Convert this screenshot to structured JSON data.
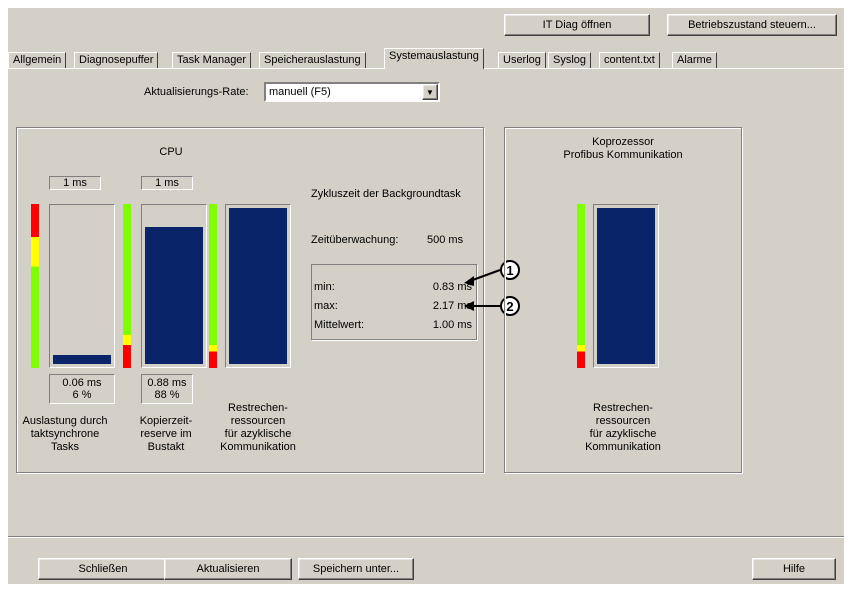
{
  "toolbar": {
    "it_diag": "IT Diag öffnen",
    "betriebszustand": "Betriebszustand steuern..."
  },
  "tabs": [
    "Allgemein",
    "Diagnosepuffer",
    "Task Manager",
    "Speicherauslastung",
    "Systemauslastung",
    "Userlog",
    "Syslog",
    "content.txt",
    "Alarme"
  ],
  "active_tab": "Systemauslastung",
  "rate": {
    "label": "Aktualisierungs-Rate:",
    "value": "manuell (F5)"
  },
  "cpu": {
    "title": "CPU",
    "col1": {
      "top": "1 ms",
      "ms": "0.06 ms",
      "pct": "6 %",
      "fill": 0.06,
      "caption": [
        "Auslastung durch",
        "taktsynchrone",
        "Tasks"
      ]
    },
    "col2": {
      "top": "1 ms",
      "ms": "0.88 ms",
      "pct": "88 %",
      "fill": 0.88,
      "caption": [
        "Kopierzeit-",
        "reserve im",
        "Bustakt"
      ]
    },
    "col3": {
      "fill": 1.0,
      "caption": [
        "Restrechen-",
        "ressourcen",
        "für azyklische",
        "Kommunikation"
      ]
    },
    "cycle_title": "Zykluszeit der Backgroundtask",
    "monitor_label": "Zeitüberwachung:",
    "monitor_value": "500 ms",
    "stats": [
      {
        "label": "min:",
        "value": "0.83 ms"
      },
      {
        "label": "max:",
        "value": "2.17 ms"
      },
      {
        "label": "Mittelwert:",
        "value": "1.00 ms"
      }
    ]
  },
  "callouts": [
    "1",
    "2"
  ],
  "coprocessor": {
    "title1": "Koprozessor",
    "title2": "Profibus Kommunikation",
    "fill": 1.0,
    "caption": [
      "Restrechen-",
      "ressourcen",
      "für azyklische",
      "Kommunikation"
    ]
  },
  "footer": {
    "close": "Schließen",
    "refresh": "Aktualisieren",
    "save": "Speichern unter...",
    "help": "Hilfe"
  },
  "colors": {
    "bar": "#0a246a",
    "red": "#ff0000",
    "yellow": "#ffff00",
    "green": "#80ff00"
  }
}
